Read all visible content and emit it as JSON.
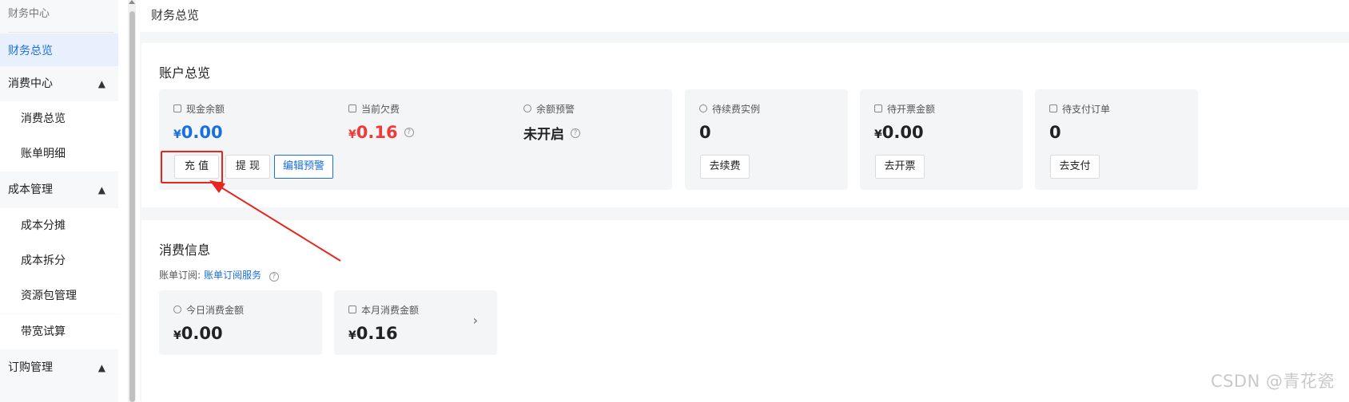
{
  "sidebar": {
    "header": "财务中心",
    "items": [
      {
        "label": "财务总览",
        "active": true
      },
      {
        "label": "消费中心",
        "group": true
      },
      {
        "label": "消费总览"
      },
      {
        "label": "账单明细"
      },
      {
        "label": "成本管理",
        "group": true
      },
      {
        "label": "成本分摊"
      },
      {
        "label": "成本拆分"
      },
      {
        "label": "资源包管理"
      },
      {
        "label": "带宽试算"
      },
      {
        "label": "订购管理",
        "group": true
      }
    ]
  },
  "header": {
    "title": "财务总览"
  },
  "account": {
    "title": "账户总览",
    "cash": {
      "label": "现金余额",
      "currency": "¥",
      "value": "0.00"
    },
    "debt": {
      "label": "当前欠费",
      "currency": "¥",
      "value": "0.16"
    },
    "alert": {
      "label": "余额预警",
      "value": "未开启"
    },
    "buttons": {
      "recharge": "充 值",
      "withdraw": "提 现",
      "edit_alert": "编辑预警"
    },
    "renew": {
      "label": "待续费实例",
      "value": "0",
      "button": "去续费"
    },
    "invoice": {
      "label": "待开票金额",
      "currency": "¥",
      "value": "0.00",
      "button": "去开票"
    },
    "orders": {
      "label": "待支付订单",
      "value": "0",
      "button": "去支付"
    }
  },
  "consumption": {
    "title": "消费信息",
    "subscribe_label": "账单订阅:",
    "subscribe_link": "账单订阅服务",
    "today": {
      "label": "今日消费金额",
      "currency": "¥",
      "value": "0.00"
    },
    "month": {
      "label": "本月消费金额",
      "currency": "¥",
      "value": "0.16"
    }
  },
  "watermark": "CSDN @青花瓷",
  "colors": {
    "accent": "#1a6fe0",
    "danger": "#f03a3a",
    "annotation": "#e8251e"
  }
}
